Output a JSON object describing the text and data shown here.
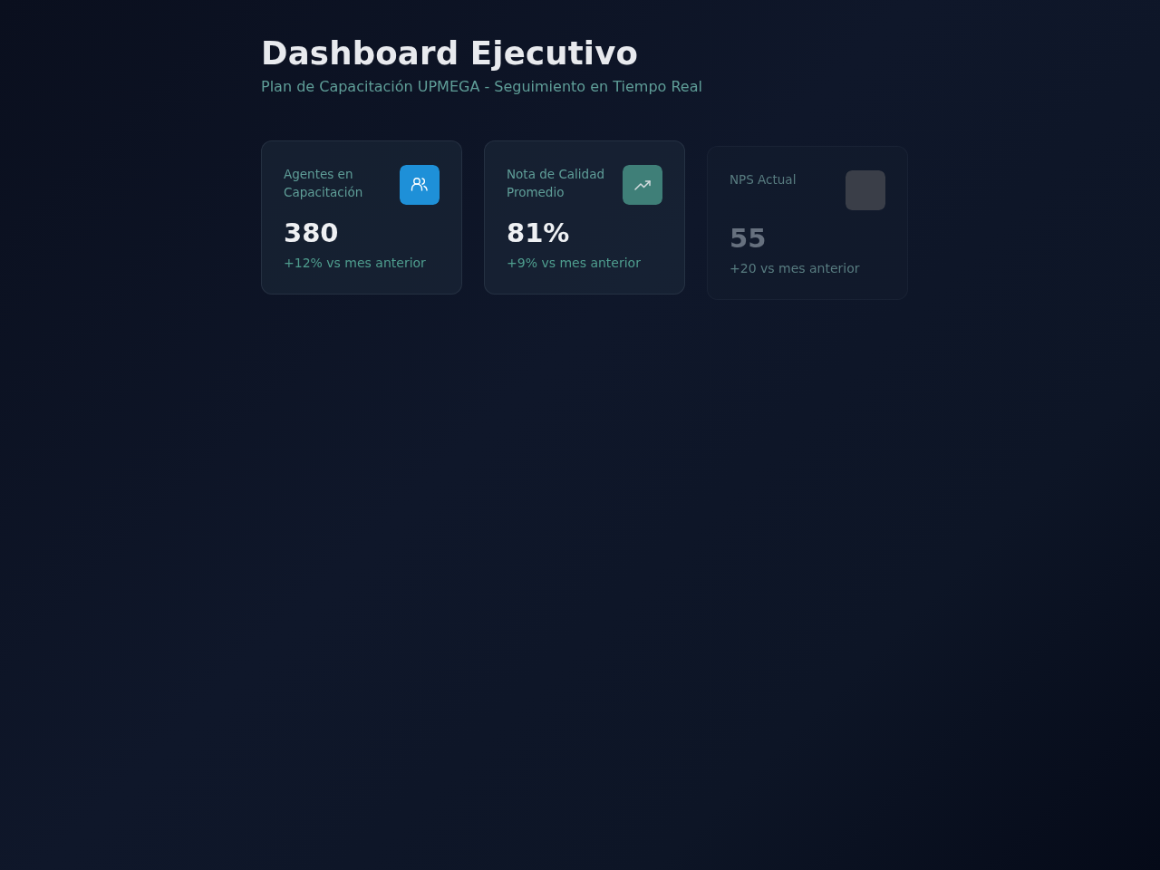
{
  "header": {
    "title": "Dashboard Ejecutivo",
    "subtitle": "Plan de Capacitación UPMEGA - Seguimiento en Tiempo Real"
  },
  "cards": [
    {
      "kind": "people",
      "label": "Agentes en Capacitación",
      "value": "380",
      "change": "+12% vs mes anterior",
      "color": "#1e90d8",
      "dimmed": false
    },
    {
      "kind": "growth",
      "label": "Nota de Calidad Promedio",
      "value": "81%",
      "change": "+9% vs mes anterior",
      "color": "#3f7f78",
      "dimmed": false
    },
    {
      "kind": "blank",
      "label": "NPS Actual",
      "value": "55",
      "change": "+20 vs mes anterior",
      "color": "#3a3e48",
      "dimmed": true
    }
  ]
}
